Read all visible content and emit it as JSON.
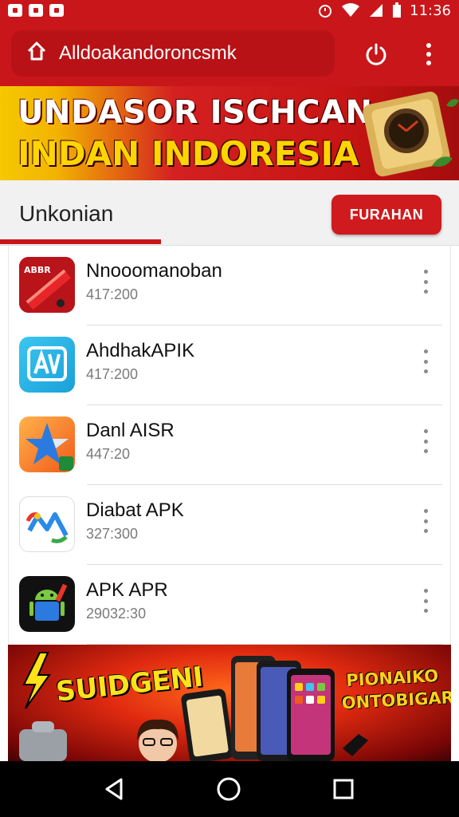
{
  "status_bar": {
    "time": "11:36"
  },
  "app_bar": {
    "url": "Alldoakandoroncsmk"
  },
  "banner_top": {
    "line1": "UNDASOR ISCHCAN",
    "line2": "INDAN INDORESIA"
  },
  "tabs": {
    "active_label": "Unkonian",
    "action_button": "FURAHAN"
  },
  "apps": [
    {
      "name": "Nnooomanoban",
      "meta": "417:200",
      "icon": "abbr-pen-icon"
    },
    {
      "name": "AhdhakAPIK",
      "meta": "417:200",
      "icon": "av-app-icon"
    },
    {
      "name": "Danl AISR",
      "meta": "447:20",
      "icon": "star-app-icon"
    },
    {
      "name": "Diabat APK",
      "meta": "327:300",
      "icon": "map-wave-icon"
    },
    {
      "name": "APK  APR",
      "meta": "29032:30",
      "icon": "android-robot-icon"
    }
  ],
  "app_icon_badge": "ABBR",
  "banner_bottom": {
    "left_text": "SUIDGENI",
    "right_text": "PIONAIKO ONTOBIGAR"
  },
  "colors": {
    "brand_red": "#c9161a",
    "yellow": "#ffd400",
    "muted_text": "#7a7a7a"
  }
}
